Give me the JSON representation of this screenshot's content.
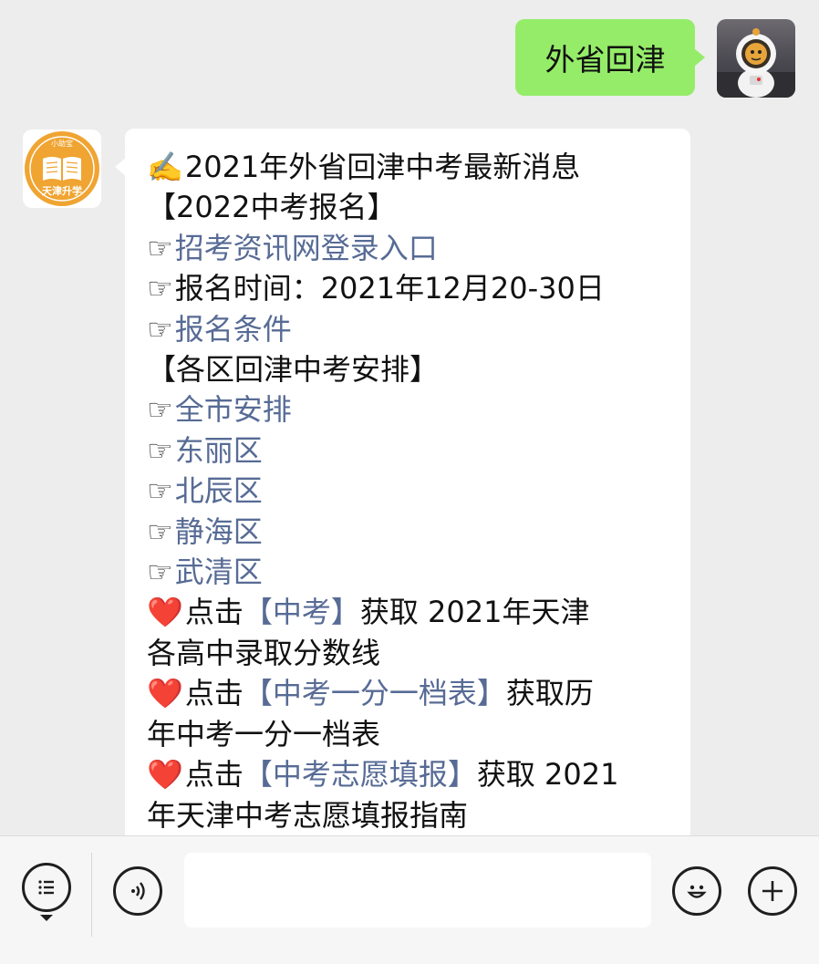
{
  "outgoing_message": {
    "text": "外省回津"
  },
  "incoming_message": {
    "lines": [
      {
        "prefix": "✍️",
        "text": "2021年外省回津中考最新消息",
        "link": false
      },
      {
        "prefix": "",
        "text": "【2022中考报名】",
        "link": false
      },
      {
        "prefix": "☞",
        "text": "招考资讯网登录入口",
        "link": true
      },
      {
        "prefix": "☞",
        "text": "报名时间：2021年12月20-30日",
        "link": false
      },
      {
        "prefix": "☞",
        "text": "报名条件",
        "link": true
      },
      {
        "prefix": "",
        "text": "【各区回津中考安排】",
        "link": false
      },
      {
        "prefix": "☞",
        "text": "全市安排",
        "link": true
      },
      {
        "prefix": "☞",
        "text": "东丽区",
        "link": true
      },
      {
        "prefix": "☞",
        "text": "北辰区",
        "link": true
      },
      {
        "prefix": "☞",
        "text": "静海区",
        "link": true
      },
      {
        "prefix": "☞",
        "text": "武清区",
        "link": true
      }
    ],
    "actions": [
      {
        "pre": "点击",
        "link": "【中考】",
        "post": "获取 2021年天津",
        "cont": "各高中录取分数线"
      },
      {
        "pre": "点击",
        "link": "【中考一分一档表】",
        "post": "获取历",
        "cont": "年中考一分一档表"
      },
      {
        "pre": "点击",
        "link": "【中考志愿填报】",
        "post": "获取 2021",
        "cont": "年天津中考志愿填报指南"
      }
    ]
  },
  "bot_avatar": {
    "top_text": "小助宝",
    "bottom_text": "天津升学"
  },
  "colors": {
    "link": "#576b95",
    "outgoing_bubble": "#95ec69",
    "avatar_orange": "#f0a431",
    "heart": "#e0242e"
  },
  "input_bar": {
    "left_icons": [
      "menu-icon",
      "voice-icon"
    ],
    "right_icons": [
      "emoji-icon",
      "plus-icon"
    ],
    "value": ""
  }
}
